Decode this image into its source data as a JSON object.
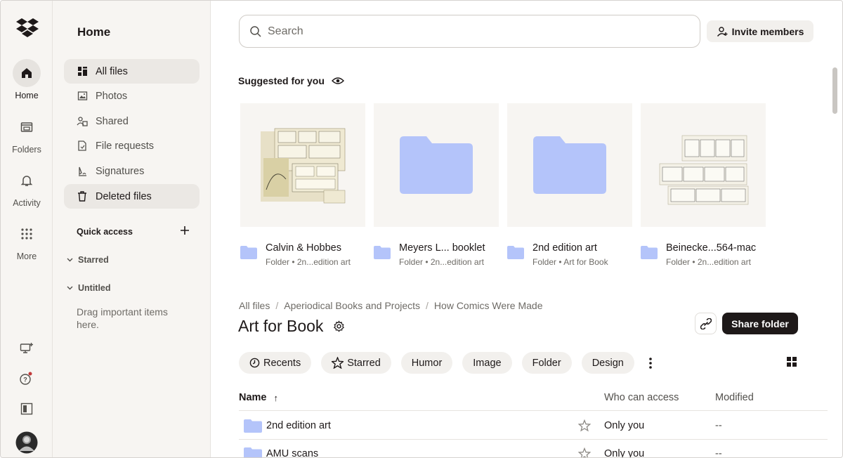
{
  "rail": {
    "items": [
      {
        "label": "Home",
        "icon": "home-icon"
      },
      {
        "label": "Folders",
        "icon": "folders-icon"
      },
      {
        "label": "Activity",
        "icon": "bell-icon"
      },
      {
        "label": "More",
        "icon": "grid-dots-icon"
      }
    ]
  },
  "sidebar": {
    "title": "Home",
    "items": [
      {
        "label": "All files",
        "icon": "all-files-icon"
      },
      {
        "label": "Photos",
        "icon": "photos-icon"
      },
      {
        "label": "Shared",
        "icon": "shared-icon"
      },
      {
        "label": "File requests",
        "icon": "file-request-icon"
      },
      {
        "label": "Signatures",
        "icon": "signature-icon"
      },
      {
        "label": "Deleted files",
        "icon": "trash-icon"
      }
    ],
    "quick_access": "Quick access",
    "groups": [
      "Starred",
      "Untitled"
    ],
    "hint": "Drag important items here."
  },
  "search": {
    "placeholder": "Search"
  },
  "invite_label": "Invite members",
  "suggested": {
    "title": "Suggested for you",
    "cards": [
      {
        "name": "Calvin & Hobbes",
        "sub": "Folder • 2n...edition art"
      },
      {
        "name": "Meyers L... booklet",
        "sub": "Folder • 2n...edition art"
      },
      {
        "name": "2nd edition art",
        "sub": "Folder • Art for Book"
      },
      {
        "name": "Beinecke...564-mac",
        "sub": "Folder • 2n...edition art"
      }
    ]
  },
  "breadcrumb": [
    "All files",
    "Aperiodical Books and Projects",
    "How Comics Were Made"
  ],
  "folder_title": "Art for Book",
  "share_label": "Share folder",
  "chips": [
    "Recents",
    "Starred",
    "Humor",
    "Image",
    "Folder",
    "Design"
  ],
  "table": {
    "headers": {
      "name": "Name",
      "access": "Who can access",
      "modified": "Modified"
    },
    "rows": [
      {
        "name": "2nd edition art",
        "access": "Only you",
        "modified": "--"
      },
      {
        "name": "AMU scans",
        "access": "Only you",
        "modified": "--"
      }
    ]
  },
  "colors": {
    "folder": "#b4c4fa",
    "accent": "#1e1919",
    "sidebar_bg": "#f7f5f2",
    "notify_dot": "#c1393a"
  }
}
